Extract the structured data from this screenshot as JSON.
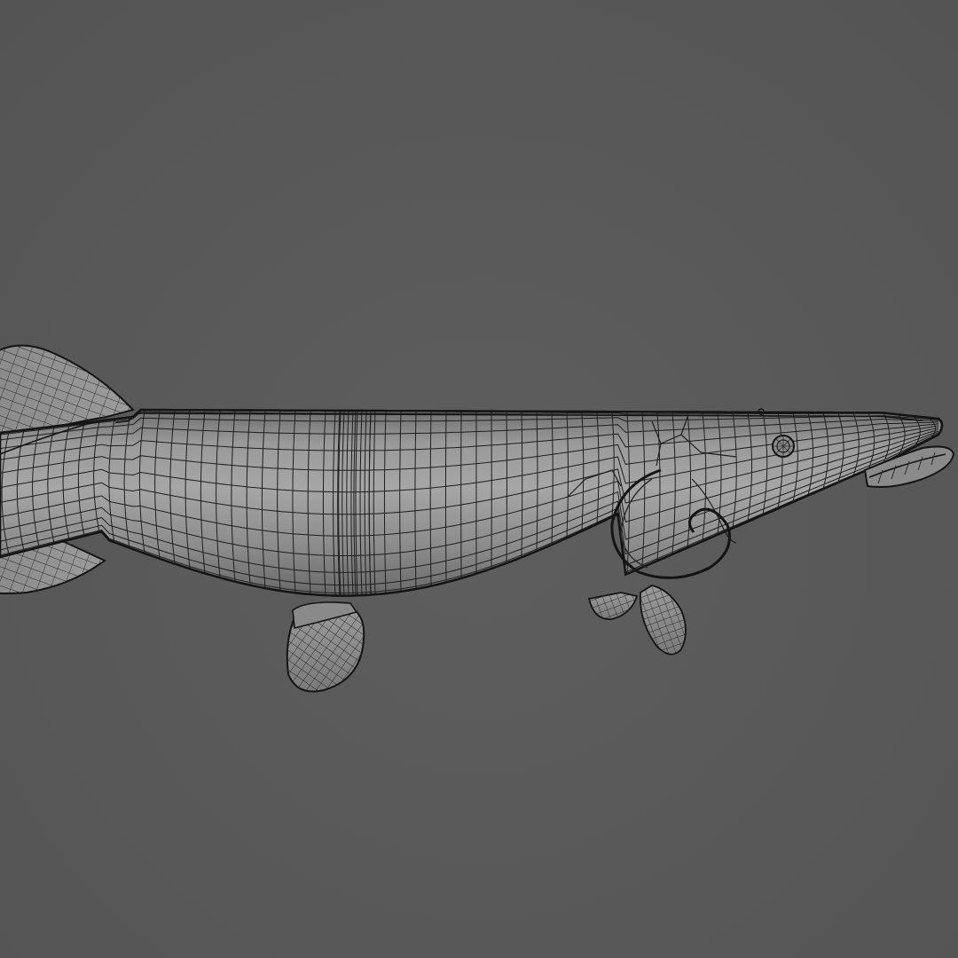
{
  "scene": {
    "subject": "fish-wireframe-model",
    "colors": {
      "background": "#5a5a5a",
      "surface_light": "#a0a0a0",
      "surface_mid": "#8c8c8c",
      "surface_dark": "#6a6a6a",
      "wire": "#1e1e1e",
      "outline": "#141414"
    }
  }
}
